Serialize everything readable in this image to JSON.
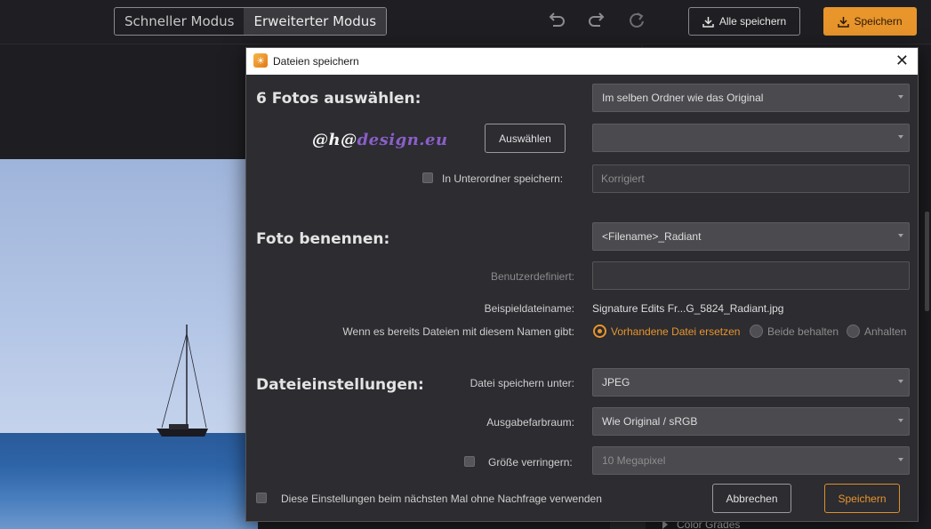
{
  "toolbar": {
    "mode_quick": "Schneller Modus",
    "mode_advanced": "Erweiterter Modus",
    "undo_icon": "undo-icon",
    "redo_icon": "redo-icon",
    "reset_icon": "reset-icon",
    "save_all": "Alle speichern",
    "save": "Speichern",
    "accent": "#e8952c"
  },
  "panel": {
    "color_grades": "Color Grades"
  },
  "dialog": {
    "title": "Dateien speichern",
    "select_photos": {
      "heading": "6 Fotos auswählen:",
      "destination": "Im selben Ordner wie das Original",
      "logo_text_1": "@",
      "logo_text_2": "h",
      "logo_text_3": "@",
      "logo_text_4": "design.eu",
      "choose_button": "Auswählen",
      "folder_value": "",
      "subfolder_label": "In Unterordner speichern:",
      "subfolder_checked": false,
      "subfolder_placeholder": "Korrigiert"
    },
    "naming": {
      "heading": "Foto benennen:",
      "pattern": "<Filename>_Radiant",
      "custom_label": "Benutzerdefiniert:",
      "custom_value": "",
      "example_label": "Beispieldateiname:",
      "example_value": "Signature Edits Fr...G_5824_Radiant.jpg",
      "conflict_label": "Wenn es bereits Dateien mit diesem Namen gibt:",
      "options": [
        "Vorhandene Datei ersetzen",
        "Beide behalten",
        "Anhalten"
      ],
      "selected_option": "Vorhandene Datei ersetzen"
    },
    "file_settings": {
      "heading": "Dateieinstellungen:",
      "format_label": "Datei speichern unter:",
      "format_value": "JPEG",
      "colorspace_label": "Ausgabefarbraum:",
      "colorspace_value": "Wie Original / sRGB",
      "resize_label": "Größe verringern:",
      "resize_checked": false,
      "resize_value": "10 Megapixel"
    },
    "remember_label": "Diese Einstellungen beim nächsten Mal ohne Nachfrage verwenden",
    "remember_checked": false,
    "cancel": "Abbrechen",
    "save": "Speichern"
  }
}
